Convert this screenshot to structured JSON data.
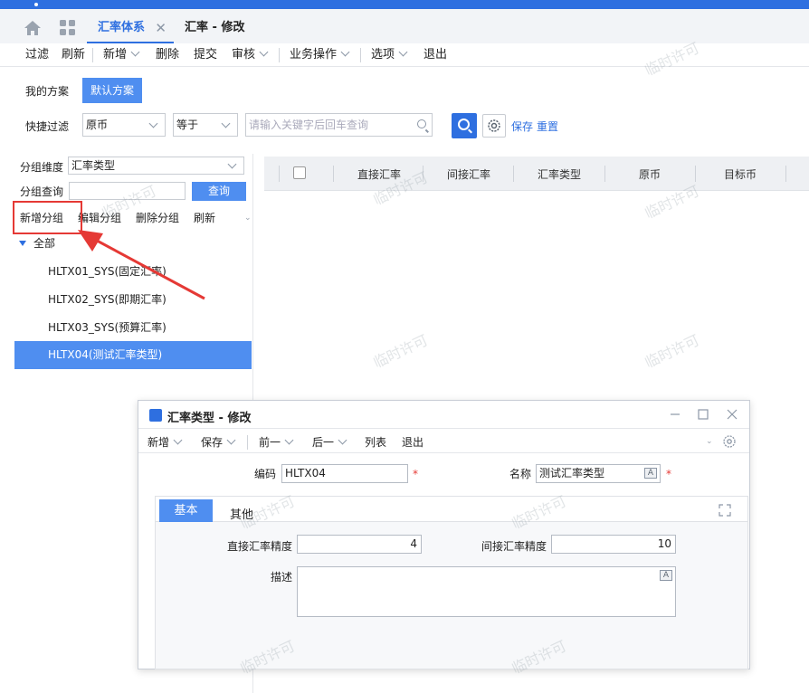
{
  "tabs": {
    "active": "汇率体系",
    "second": "汇率 - 修改"
  },
  "toolbar": {
    "filter": "过滤",
    "refresh": "刷新",
    "add": "新增",
    "delete": "删除",
    "submit": "提交",
    "audit": "审核",
    "business": "业务操作",
    "options": "选项",
    "exit": "退出"
  },
  "scheme": {
    "mine": "我的方案",
    "default": "默认方案"
  },
  "quick_filter": {
    "label": "快捷过滤",
    "field": "原币",
    "operator": "等于",
    "placeholder": "请输入关键字后回车查询",
    "save": "保存",
    "reset": "重置"
  },
  "group": {
    "dimension_label": "分组维度",
    "dimension_value": "汇率类型",
    "query_label": "分组查询",
    "query_button": "查询",
    "actions": [
      "新增分组",
      "编辑分组",
      "删除分组",
      "刷新"
    ]
  },
  "tree": {
    "root": "全部",
    "items": [
      "HLTX01_SYS(固定汇率)",
      "HLTX02_SYS(即期汇率)",
      "HLTX03_SYS(预算汇率)",
      "HLTX04(测试汇率类型)"
    ]
  },
  "grid": {
    "columns": [
      "直接汇率",
      "间接汇率",
      "汇率类型",
      "原币",
      "目标币"
    ]
  },
  "watermark": "临时许可",
  "dialog": {
    "title": "汇率类型 - 修改",
    "toolbar": {
      "add": "新增",
      "save": "保存",
      "prev": "前一",
      "next": "后一",
      "list": "列表",
      "exit": "退出"
    },
    "code_label": "编码",
    "code_value": "HLTX04",
    "name_label": "名称",
    "name_value": "测试汇率类型",
    "required_mark": "*",
    "tab_basic": "基本",
    "tab_other": "其他",
    "direct_precision_label": "直接汇率精度",
    "direct_precision_value": "4",
    "indirect_precision_label": "间接汇率精度",
    "indirect_precision_value": "10",
    "description_label": "描述",
    "description_value": ""
  },
  "colors": {
    "accent": "#2e6fe0",
    "selected": "#4f8ef0",
    "annotation": "#e53935"
  }
}
